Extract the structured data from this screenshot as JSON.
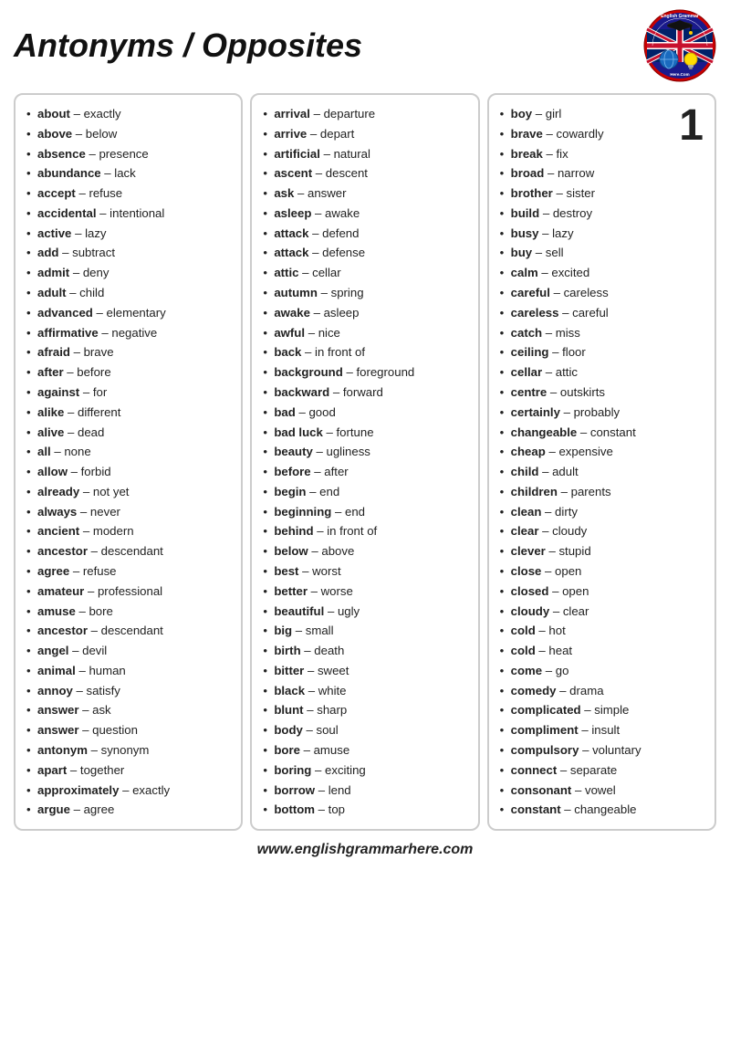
{
  "title": "Antonyms / Opposites",
  "footer": "www.englishgrammarhere.com",
  "badge": "1",
  "col1": [
    {
      "word": "about",
      "opp": "exactly"
    },
    {
      "word": "above",
      "opp": "below"
    },
    {
      "word": "absence",
      "opp": "presence"
    },
    {
      "word": "abundance",
      "opp": "lack"
    },
    {
      "word": "accept",
      "opp": "refuse"
    },
    {
      "word": "accidental",
      "opp": "intentional"
    },
    {
      "word": "active",
      "opp": "lazy"
    },
    {
      "word": "add",
      "opp": "subtract"
    },
    {
      "word": "admit",
      "opp": "deny"
    },
    {
      "word": "adult",
      "opp": "child"
    },
    {
      "word": "advanced",
      "opp": "elementary"
    },
    {
      "word": "affirmative",
      "opp": "negative"
    },
    {
      "word": "afraid",
      "opp": "brave"
    },
    {
      "word": "after",
      "opp": "before"
    },
    {
      "word": "against",
      "opp": "for"
    },
    {
      "word": "alike",
      "opp": "different"
    },
    {
      "word": "alive",
      "opp": "dead"
    },
    {
      "word": "all",
      "opp": "none"
    },
    {
      "word": "allow",
      "opp": "forbid"
    },
    {
      "word": "already",
      "opp": "not yet"
    },
    {
      "word": "always",
      "opp": "never"
    },
    {
      "word": "ancient",
      "opp": "modern"
    },
    {
      "word": "ancestor",
      "opp": "descendant"
    },
    {
      "word": "agree",
      "opp": "refuse"
    },
    {
      "word": "amateur",
      "opp": "professional"
    },
    {
      "word": "amuse",
      "opp": "bore"
    },
    {
      "word": "ancestor",
      "opp": "descendant"
    },
    {
      "word": "angel",
      "opp": "devil"
    },
    {
      "word": "animal",
      "opp": "human"
    },
    {
      "word": "annoy",
      "opp": "satisfy"
    },
    {
      "word": "answer",
      "opp": "ask"
    },
    {
      "word": "answer",
      "opp": "question"
    },
    {
      "word": "antonym",
      "opp": "synonym"
    },
    {
      "word": "apart",
      "opp": "together"
    },
    {
      "word": "approximately",
      "opp": "exactly"
    },
    {
      "word": "argue",
      "opp": "agree"
    }
  ],
  "col2": [
    {
      "word": "arrival",
      "opp": "departure"
    },
    {
      "word": "arrive",
      "opp": "depart"
    },
    {
      "word": "artificial",
      "opp": "natural"
    },
    {
      "word": "ascent",
      "opp": "descent"
    },
    {
      "word": "ask",
      "opp": "answer"
    },
    {
      "word": "asleep",
      "opp": "awake"
    },
    {
      "word": "attack",
      "opp": "defend"
    },
    {
      "word": "attack",
      "opp": "defense"
    },
    {
      "word": "attic",
      "opp": "cellar"
    },
    {
      "word": "autumn",
      "opp": "spring"
    },
    {
      "word": "awake",
      "opp": "asleep"
    },
    {
      "word": "awful",
      "opp": "nice"
    },
    {
      "word": "back",
      "opp": "in front of"
    },
    {
      "word": "background",
      "opp": "foreground"
    },
    {
      "word": "backward",
      "opp": "forward"
    },
    {
      "word": "bad",
      "opp": "good"
    },
    {
      "word": "bad luck",
      "opp": "fortune"
    },
    {
      "word": "beauty",
      "opp": "ugliness"
    },
    {
      "word": "before",
      "opp": "after"
    },
    {
      "word": "begin",
      "opp": "end"
    },
    {
      "word": "beginning",
      "opp": "end"
    },
    {
      "word": "behind",
      "opp": "in front of"
    },
    {
      "word": "below",
      "opp": "above"
    },
    {
      "word": "best",
      "opp": "worst"
    },
    {
      "word": "better",
      "opp": "worse"
    },
    {
      "word": "beautiful",
      "opp": "ugly"
    },
    {
      "word": "big",
      "opp": "small"
    },
    {
      "word": "birth",
      "opp": "death"
    },
    {
      "word": "bitter",
      "opp": "sweet"
    },
    {
      "word": "black",
      "opp": "white"
    },
    {
      "word": "blunt",
      "opp": "sharp"
    },
    {
      "word": "body",
      "opp": "soul"
    },
    {
      "word": "bore",
      "opp": "amuse"
    },
    {
      "word": "boring",
      "opp": "exciting"
    },
    {
      "word": "borrow",
      "opp": "lend"
    },
    {
      "word": "bottom",
      "opp": "top"
    }
  ],
  "col3": [
    {
      "word": "boy",
      "opp": "girl"
    },
    {
      "word": "brave",
      "opp": "cowardly"
    },
    {
      "word": "break",
      "opp": "fix"
    },
    {
      "word": "broad",
      "opp": "narrow"
    },
    {
      "word": "brother",
      "opp": "sister"
    },
    {
      "word": "build",
      "opp": "destroy"
    },
    {
      "word": "busy",
      "opp": "lazy"
    },
    {
      "word": "buy",
      "opp": "sell"
    },
    {
      "word": "calm",
      "opp": "excited"
    },
    {
      "word": "careful",
      "opp": "careless"
    },
    {
      "word": "careless",
      "opp": "careful"
    },
    {
      "word": "catch",
      "opp": "miss"
    },
    {
      "word": "ceiling",
      "opp": "floor"
    },
    {
      "word": "cellar",
      "opp": "attic"
    },
    {
      "word": "centre",
      "opp": "outskirts"
    },
    {
      "word": "certainly",
      "opp": "probably"
    },
    {
      "word": "changeable",
      "opp": "constant"
    },
    {
      "word": "cheap",
      "opp": "expensive"
    },
    {
      "word": "child",
      "opp": "adult"
    },
    {
      "word": "children",
      "opp": "parents"
    },
    {
      "word": "clean",
      "opp": "dirty"
    },
    {
      "word": "clear",
      "opp": "cloudy"
    },
    {
      "word": "clever",
      "opp": "stupid"
    },
    {
      "word": "close",
      "opp": "open"
    },
    {
      "word": "closed",
      "opp": "open"
    },
    {
      "word": "cloudy",
      "opp": "clear"
    },
    {
      "word": "cold",
      "opp": "hot"
    },
    {
      "word": "cold",
      "opp": "heat"
    },
    {
      "word": "come",
      "opp": "go"
    },
    {
      "word": "comedy",
      "opp": "drama"
    },
    {
      "word": "complicated",
      "opp": "simple"
    },
    {
      "word": "compliment",
      "opp": "insult"
    },
    {
      "word": "compulsory",
      "opp": "voluntary"
    },
    {
      "word": "connect",
      "opp": "separate"
    },
    {
      "word": "consonant",
      "opp": "vowel"
    },
    {
      "word": "constant",
      "opp": "changeable"
    }
  ]
}
